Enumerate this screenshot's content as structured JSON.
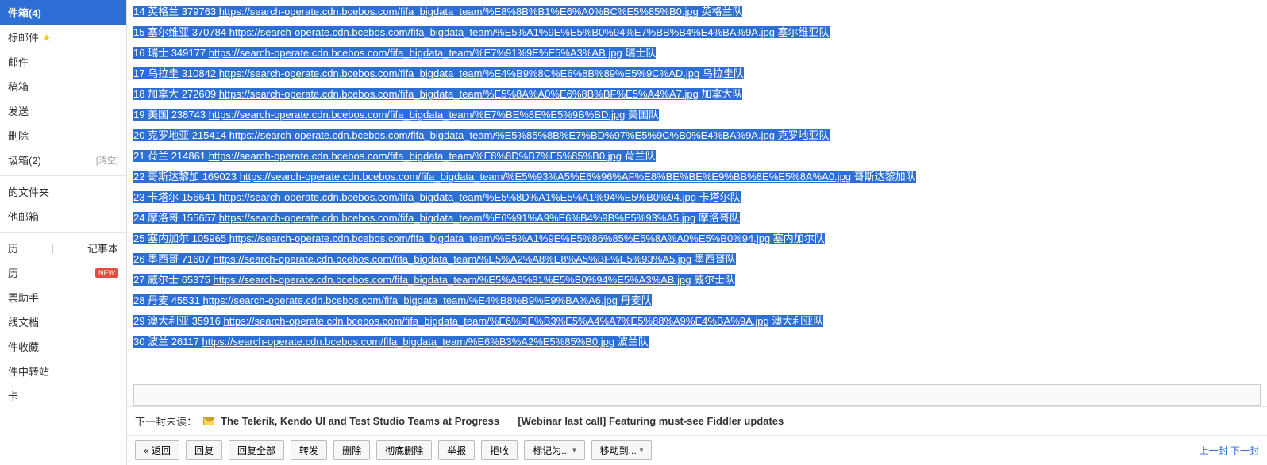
{
  "sidebar": {
    "items": [
      {
        "label": "件箱(4)",
        "active": true
      },
      {
        "label": "标邮件",
        "star": true
      },
      {
        "label": "邮件"
      },
      {
        "label": "稿箱"
      },
      {
        "label": "发送"
      },
      {
        "label": "删除"
      },
      {
        "label": "圾箱(2)",
        "clear": "[清空]"
      }
    ],
    "group2": [
      {
        "label": "的文件夹"
      },
      {
        "label": "他邮箱"
      }
    ],
    "group3": [
      {
        "label_a": "历",
        "sep": "|",
        "label_b": "记事本"
      },
      {
        "label": "历",
        "new": "NEW"
      },
      {
        "label": "票助手"
      },
      {
        "label": "线文档"
      },
      {
        "label": "件收藏"
      },
      {
        "label": "件中转站"
      },
      {
        "label": "卡"
      }
    ]
  },
  "rows": [
    {
      "n": "14",
      "name": "英格兰",
      "val": "379763",
      "url": "https://search-operate.cdn.bcebos.com/fifa_bigdata_team/%E8%8B%B1%E6%A0%BC%E5%85%B0.jpg",
      "team": "英格兰队"
    },
    {
      "n": "15",
      "name": "塞尔维亚",
      "val": "370784",
      "url": "https://search-operate.cdn.bcebos.com/fifa_bigdata_team/%E5%A1%9E%E5%B0%94%E7%BB%B4%E4%BA%9A.jpg",
      "team": "塞尔维亚队"
    },
    {
      "n": "16",
      "name": "瑞士",
      "val": "349177",
      "url": "https://search-operate.cdn.bcebos.com/fifa_bigdata_team/%E7%91%9E%E5%A3%AB.jpg",
      "team": "瑞士队"
    },
    {
      "n": "17",
      "name": "乌拉圭",
      "val": "310842",
      "url": "https://search-operate.cdn.bcebos.com/fifa_bigdata_team/%E4%B9%8C%E6%8B%89%E5%9C%AD.jpg",
      "team": "乌拉圭队"
    },
    {
      "n": "18",
      "name": "加拿大",
      "val": "272609",
      "url": "https://search-operate.cdn.bcebos.com/fifa_bigdata_team/%E5%8A%A0%E6%8B%BF%E5%A4%A7.jpg",
      "team": "加拿大队"
    },
    {
      "n": "19",
      "name": "美国",
      "val": "238743",
      "url": "https://search-operate.cdn.bcebos.com/fifa_bigdata_team/%E7%BE%8E%E5%9B%BD.jpg",
      "team": "美国队"
    },
    {
      "n": "20",
      "name": "克罗地亚",
      "val": "215414",
      "url": "https://search-operate.cdn.bcebos.com/fifa_bigdata_team/%E5%85%8B%E7%BD%97%E5%9C%B0%E4%BA%9A.jpg",
      "team": "克罗地亚队"
    },
    {
      "n": "21",
      "name": "荷兰",
      "val": "214861",
      "url": "https://search-operate.cdn.bcebos.com/fifa_bigdata_team/%E8%8D%B7%E5%85%B0.jpg",
      "team": "荷兰队"
    },
    {
      "n": "22",
      "name": "哥斯达黎加",
      "val": "169023",
      "url": "https://search-operate.cdn.bcebos.com/fifa_bigdata_team/%E5%93%A5%E6%96%AF%E8%BE%BE%E9%BB%8E%E5%8A%A0.jpg",
      "team": "哥斯达黎加队"
    },
    {
      "n": "23",
      "name": "卡塔尔",
      "val": "156641",
      "url": "https://search-operate.cdn.bcebos.com/fifa_bigdata_team/%E5%8D%A1%E5%A1%94%E5%B0%94.jpg",
      "team": "卡塔尔队"
    },
    {
      "n": "24",
      "name": "摩洛哥",
      "val": "155657",
      "url": "https://search-operate.cdn.bcebos.com/fifa_bigdata_team/%E6%91%A9%E6%B4%9B%E5%93%A5.jpg",
      "team": "摩洛哥队"
    },
    {
      "n": "25",
      "name": "塞内加尔",
      "val": "105965",
      "url": "https://search-operate.cdn.bcebos.com/fifa_bigdata_team/%E5%A1%9E%E5%86%85%E5%8A%A0%E5%B0%94.jpg",
      "team": "塞内加尔队"
    },
    {
      "n": "26",
      "name": "墨西哥",
      "val": "71607",
      "url": "https://search-operate.cdn.bcebos.com/fifa_bigdata_team/%E5%A2%A8%E8%A5%BF%E5%93%A5.jpg",
      "team": "墨西哥队"
    },
    {
      "n": "27",
      "name": "威尔士",
      "val": "65375",
      "url": "https://search-operate.cdn.bcebos.com/fifa_bigdata_team/%E5%A8%81%E5%B0%94%E5%A3%AB.jpg",
      "team": "威尔士队"
    },
    {
      "n": "28",
      "name": "丹麦",
      "val": "45531",
      "url": "https://search-operate.cdn.bcebos.com/fifa_bigdata_team/%E4%B8%B9%E9%BA%A6.jpg",
      "team": "丹麦队"
    },
    {
      "n": "29",
      "name": "澳大利亚",
      "val": "35916",
      "url": "https://search-operate.cdn.bcebos.com/fifa_bigdata_team/%E6%BE%B3%E5%A4%A7%E5%88%A9%E4%BA%9A.jpg",
      "team": "澳大利亚队"
    },
    {
      "n": "30",
      "name": "波兰",
      "val": "26117",
      "url": "https://search-operate.cdn.bcebos.com/fifa_bigdata_team/%E6%B3%A2%E5%85%B0.jpg",
      "team": "波兰队"
    }
  ],
  "next": {
    "label": "下一封未读：",
    "subject_a": "The Telerik, Kendo UI and Test Studio Teams at Progress",
    "subject_b": "[Webinar last call] Featuring must-see Fiddler updates"
  },
  "toolbar": {
    "back": "« 返回",
    "reply": "回复",
    "reply_all": "回复全部",
    "forward": "转发",
    "delete": "删除",
    "delete_perm": "彻底删除",
    "report": "举报",
    "reject": "拒收",
    "mark_as": "标记为...",
    "move_to": "移动到...",
    "prev": "上一封",
    "next": "下一封"
  }
}
